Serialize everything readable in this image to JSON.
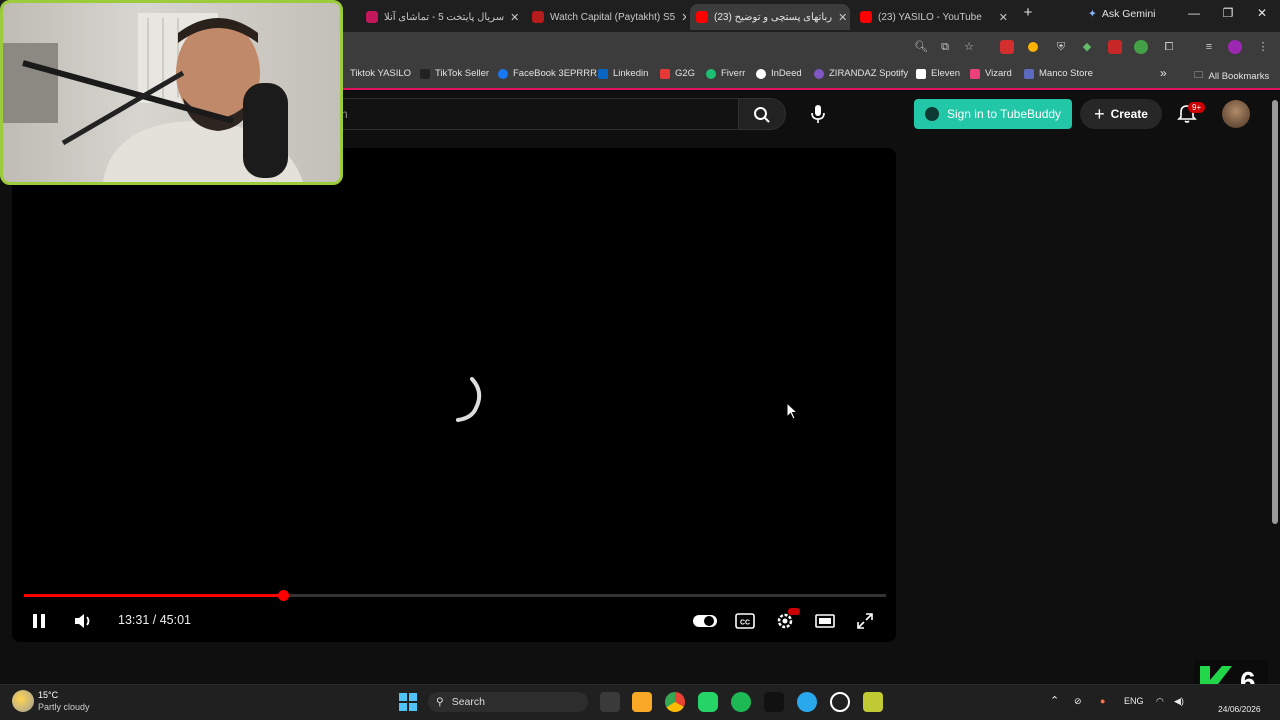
{
  "browser": {
    "tabs": [
      {
        "label": "سریال پایتخت 5 - تماشای آنلا",
        "favicon_color": "#c2185b",
        "active": false
      },
      {
        "label": "Watch Capital (Paytakht) S5",
        "favicon_color": "#b71c1c",
        "active": false
      },
      {
        "label": "(23) رباتهای پستچی و توضیح",
        "favicon_color": "#ff0000",
        "active": true
      },
      {
        "label": "(23) YASILO - YouTube",
        "favicon_color": "#ff0000",
        "active": false
      }
    ],
    "new_tab_label": "+",
    "ask_gemini_label": "Ask Gemini",
    "bookmarks": [
      {
        "label": "Tiktok YASILO",
        "color": "#3c3c3c"
      },
      {
        "label": "TikTok Seller",
        "color": "#111111"
      },
      {
        "label": "FaceBook 3EPRRR",
        "color": "#1877f2"
      },
      {
        "label": "Linkedin",
        "color": "#0a66c2"
      },
      {
        "label": "G2G",
        "color": "#e53935"
      },
      {
        "label": "Fiverr",
        "color": "#1dbf73"
      },
      {
        "label": "InDeed",
        "color": "#ffffff"
      },
      {
        "label": "ZIRANDAZ Spotify",
        "color": "#7e57c2"
      },
      {
        "label": "Eleven",
        "color": "#ffffff"
      },
      {
        "label": "Vizard",
        "color": "#ec407a"
      },
      {
        "label": "Manco Store",
        "color": "#5c6bc0"
      }
    ],
    "more_bookmarks": "»",
    "all_bookmarks_label": "All Bookmarks"
  },
  "youtube": {
    "search_placeholder": "h",
    "tubebuddy_label": "Sign in to TubeBuddy",
    "create_label": "Create",
    "notifications_badge": "9+",
    "accent": "#ff0000"
  },
  "player": {
    "time_display": "13:31 / 45:01",
    "progress_fraction": 0.3,
    "state": "buffering"
  },
  "taskbar": {
    "weather_temp": "15°C",
    "weather_desc": "Partly cloudy",
    "search_label": "Search",
    "language": "ENG",
    "date": "24/06/2026"
  },
  "overlay": {
    "k6_text": "6"
  }
}
